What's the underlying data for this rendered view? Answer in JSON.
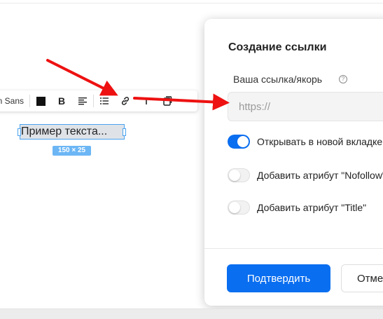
{
  "toolbar": {
    "font_label": "n Sans",
    "bold_label": "B",
    "color_swatch": "#111111",
    "icons": [
      "text-color-icon",
      "bold-icon",
      "align-left-icon",
      "list-icon",
      "link-icon",
      "text-size-icon",
      "copy-icon"
    ]
  },
  "canvas": {
    "sample_text": "Пример текста...",
    "dimensions_label": "150 × 25"
  },
  "modal": {
    "title": "Создание ссылки",
    "field_label": "Ваша ссылка/якорь",
    "help_glyph": "?",
    "url_value": "",
    "url_placeholder": "https://",
    "options": [
      {
        "label": "Открывать в новой вкладке",
        "enabled": true
      },
      {
        "label": "Добавить атрибут \"Nofollow\"",
        "enabled": false
      },
      {
        "label": "Добавить атрибут \"Title\"",
        "enabled": false
      }
    ],
    "confirm_label": "Подтвердить",
    "cancel_label": "Отмена"
  },
  "colors": {
    "accent": "#0a6ef0",
    "annotation_arrow": "#ee1111",
    "selection": "#4aa3f0"
  }
}
